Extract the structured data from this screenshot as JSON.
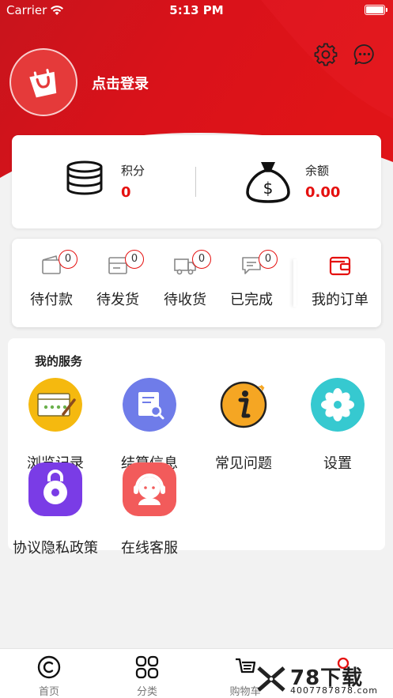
{
  "status_bar": {
    "carrier": "Carrier",
    "time": "5:13 PM"
  },
  "colors": {
    "brand_red": "#e5100f",
    "header_red": "#d9121a"
  },
  "header": {
    "login_label": "点击登录",
    "avatar_icon": "shopping-bag-icon",
    "settings_icon": "gear-icon",
    "message_icon": "chat-bubble-icon"
  },
  "wallet": {
    "points": {
      "label": "积分",
      "value": "0",
      "icon": "coin-stack-icon"
    },
    "balance": {
      "label": "余额",
      "value": "0.00",
      "icon": "money-bag-icon"
    }
  },
  "orders": {
    "items": [
      {
        "label": "待付款",
        "count": "0",
        "icon": "wallet-icon"
      },
      {
        "label": "待发货",
        "count": "0",
        "icon": "package-icon"
      },
      {
        "label": "待收货",
        "count": "0",
        "icon": "truck-icon"
      },
      {
        "label": "已完成",
        "count": "0",
        "icon": "message-check-icon"
      }
    ],
    "all_orders_label": "我的订单"
  },
  "services": {
    "title": "我的服务",
    "items": [
      {
        "label": "浏览记录",
        "icon": "browser-history-icon",
        "color": "#f5b90f"
      },
      {
        "label": "结算信息",
        "icon": "settlement-icon",
        "color": "#6f7ce9"
      },
      {
        "label": "常见问题",
        "icon": "info-icon",
        "color": "#f5a623"
      },
      {
        "label": "设置",
        "icon": "flower-icon",
        "color": "#36c9d0"
      },
      {
        "label": "协议隐私政策",
        "icon": "lock-icon",
        "color": "#7a3ce6"
      },
      {
        "label": "在线客服",
        "icon": "customer-service-icon",
        "color": "#f25b5b"
      }
    ]
  },
  "tabbar": {
    "items": [
      {
        "label": "首页",
        "icon": "copyright-circle-icon"
      },
      {
        "label": "分类",
        "icon": "grid-icon"
      },
      {
        "label": "购物车",
        "icon": "cart-icon"
      }
    ]
  },
  "watermark": {
    "main": "78下载",
    "sub": "4007787878.com"
  }
}
